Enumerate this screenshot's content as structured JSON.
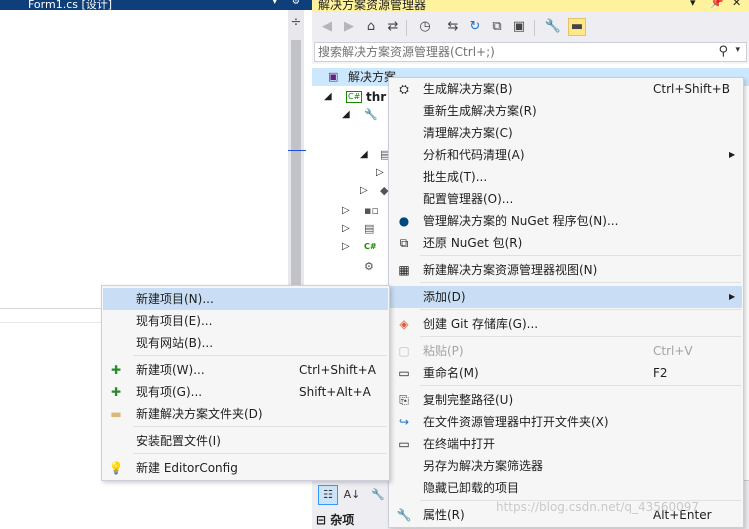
{
  "document_tab": {
    "label": "Form1.cs [设计]"
  },
  "solution_explorer": {
    "title": "解决方案资源管理器",
    "pin_icon": "pin-icon",
    "close_glyph": "✕",
    "dropdown_glyph": "▾",
    "search_placeholder": "搜索解决方案资源管理器(Ctrl+;)",
    "tree": {
      "solution_label": "解决方案",
      "project_prefix": "thr",
      "csharp_badge": "C#",
      "csharp_badge_2": "C#"
    }
  },
  "properties": {
    "category": "杂项"
  },
  "context_menu": {
    "items": [
      {
        "label": "生成解决方案(B)",
        "shortcut": "Ctrl+Shift+B",
        "icon": "build-icon"
      },
      {
        "label": "重新生成解决方案(R)",
        "shortcut": "",
        "icon": ""
      },
      {
        "label": "清理解决方案(C)",
        "shortcut": "",
        "icon": ""
      },
      {
        "label": "分析和代码清理(A)",
        "shortcut": "",
        "icon": "",
        "submenu": true
      },
      {
        "label": "批生成(T)...",
        "shortcut": "",
        "icon": ""
      },
      {
        "label": "配置管理器(O)...",
        "shortcut": "",
        "icon": ""
      },
      {
        "label": "管理解决方案的 NuGet 程序包(N)...",
        "shortcut": "",
        "icon": "nuget-icon"
      },
      {
        "label": "还原 NuGet 包(R)",
        "shortcut": "",
        "icon": "restore-packages-icon"
      },
      {
        "label": "新建解决方案资源管理器视图(N)",
        "shortcut": "",
        "icon": "new-view-icon"
      },
      {
        "label": "添加(D)",
        "shortcut": "",
        "icon": "",
        "submenu": true,
        "highlighted": true
      },
      {
        "label": "创建 Git 存储库(G)...",
        "shortcut": "",
        "icon": "git-icon"
      },
      {
        "label": "粘贴(P)",
        "shortcut": "Ctrl+V",
        "icon": "paste-icon",
        "disabled": true
      },
      {
        "label": "重命名(M)",
        "shortcut": "F2",
        "icon": "rename-icon"
      },
      {
        "label": "复制完整路径(U)",
        "shortcut": "",
        "icon": "copy-path-icon"
      },
      {
        "label": "在文件资源管理器中打开文件夹(X)",
        "shortcut": "",
        "icon": "open-folder-icon"
      },
      {
        "label": "在终端中打开",
        "shortcut": "",
        "icon": "terminal-icon"
      },
      {
        "label": "另存为解决方案筛选器",
        "shortcut": "",
        "icon": ""
      },
      {
        "label": "隐藏已卸载的项目",
        "shortcut": "",
        "icon": ""
      },
      {
        "label": "属性(R)",
        "shortcut": "Alt+Enter",
        "icon": "wrench-icon"
      }
    ],
    "submenu_arrow": "▶"
  },
  "add_submenu": {
    "items": [
      {
        "label": "新建项目(N)...",
        "shortcut": "",
        "icon": "",
        "highlighted": true
      },
      {
        "label": "现有项目(E)...",
        "shortcut": "",
        "icon": ""
      },
      {
        "label": "现有网站(B)...",
        "shortcut": "",
        "icon": ""
      },
      {
        "label": "新建项(W)...",
        "shortcut": "Ctrl+Shift+A",
        "icon": "new-item-icon"
      },
      {
        "label": "现有项(G)...",
        "shortcut": "Shift+Alt+A",
        "icon": "existing-item-icon"
      },
      {
        "label": "新建解决方案文件夹(D)",
        "shortcut": "",
        "icon": "solution-folder-icon"
      },
      {
        "label": "安装配置文件(I)",
        "shortcut": "",
        "icon": ""
      },
      {
        "label": "新建 EditorConfig",
        "shortcut": "",
        "icon": "lightbulb-icon"
      }
    ]
  },
  "watermark": "https://blog.csdn.net/q_43560097"
}
